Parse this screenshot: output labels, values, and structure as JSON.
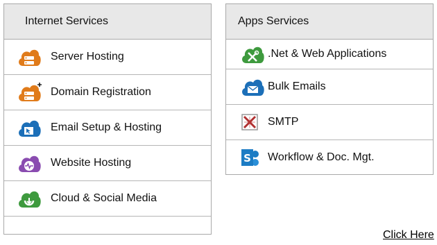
{
  "internet_services": {
    "title": "Internet Services",
    "items": [
      {
        "label": "Server Hosting",
        "icon": "server-cloud-icon",
        "color": "#e07b1a"
      },
      {
        "label": "Domain Registration",
        "icon": "domain-cloud-icon",
        "color": "#e07b1a"
      },
      {
        "label": "Email Setup & Hosting",
        "icon": "email-cloud-icon",
        "color": "#1c6fb8"
      },
      {
        "label": "Website Hosting",
        "icon": "website-cloud-icon",
        "color": "#8a4cb0"
      },
      {
        "label": "Cloud & Social Media",
        "icon": "cloud-download-icon",
        "color": "#3e9a3e"
      }
    ]
  },
  "apps_services": {
    "title": "Apps Services",
    "items": [
      {
        "label": ".Net & Web Applications",
        "icon": "tools-cloud-icon",
        "color": "#3e9a3e"
      },
      {
        "label": "Bulk Emails",
        "icon": "mail-cloud-icon",
        "color": "#1c6fb8"
      },
      {
        "label": "SMTP",
        "icon": "smtp-icon",
        "color": "#b03030"
      },
      {
        "label": "Workflow & Doc. Mgt.",
        "icon": "sharepoint-icon",
        "color": "#1c7cc4"
      }
    ]
  },
  "footer": {
    "link_label": "Click Here"
  }
}
